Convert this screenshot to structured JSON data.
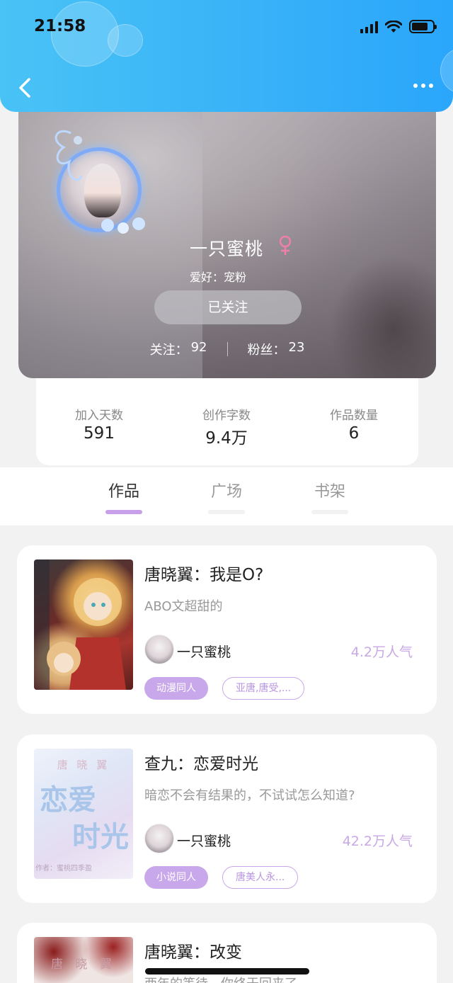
{
  "status_bar": {
    "time": "21:58"
  },
  "profile": {
    "name": "一只蜜桃",
    "hobby": "爱好：宠粉",
    "follow_button": "已关注",
    "following_label": "关注：",
    "following_count": "92",
    "fans_label": "粉丝：",
    "fans_count": "23"
  },
  "stats": [
    {
      "label": "加入天数",
      "value": "591"
    },
    {
      "label": "创作字数",
      "value": "9.4万"
    },
    {
      "label": "作品数量",
      "value": "6"
    }
  ],
  "tabs": [
    {
      "label": "作品",
      "active": true
    },
    {
      "label": "广场",
      "active": false
    },
    {
      "label": "书架",
      "active": false
    }
  ],
  "books": [
    {
      "title": "唐晓翼：我是O?",
      "desc": "ABO文超甜的",
      "author": "一只蜜桃",
      "popularity": "4.2万人气",
      "tags": [
        "动漫同人",
        "亚唐,唐受,..."
      ]
    },
    {
      "title": "查九：恋爱时光",
      "desc": "暗恋不会有结果的，不试试怎么知道?",
      "author": "一只蜜桃",
      "popularity": "42.2万人气",
      "tags": [
        "小说同人",
        "唐美人永..."
      ],
      "cover_text": {
        "top": "唐 晓 翼",
        "main1": "恋爱",
        "main2": "时光",
        "author": "作者：蜜桃四季盈"
      }
    },
    {
      "title": "唐晓翼：改变",
      "desc": "两年的等待，你终于回来了",
      "cover_text": {
        "top": "唐 晓 翼"
      }
    }
  ],
  "colors": {
    "header": "#3cb5f7",
    "accent": "#c8a8ea",
    "background": "#f2f2f2"
  }
}
